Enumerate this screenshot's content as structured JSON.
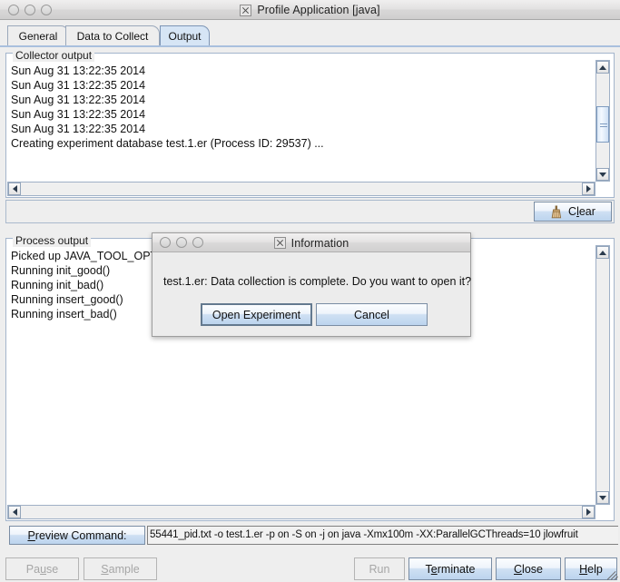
{
  "window": {
    "title": "Profile Application [java]",
    "app_icon": "x-logo-icon",
    "controls": [
      "close-circle",
      "minimize-circle",
      "zoom-circle"
    ]
  },
  "tabs": [
    {
      "label": "General",
      "selected": false
    },
    {
      "label": "Data to Collect",
      "selected": false
    },
    {
      "label": "Output",
      "selected": true
    }
  ],
  "collector_output": {
    "legend": "Collector output",
    "lines": [
      "Sun Aug 31 13:22:35 2014",
      "Sun Aug 31 13:22:35 2014",
      "Sun Aug 31 13:22:35 2014",
      "Sun Aug 31 13:22:35 2014",
      "Sun Aug 31 13:22:35 2014",
      "Creating experiment database test.1.er (Process ID: 29537) ..."
    ]
  },
  "clear_button": {
    "label": "Clear",
    "mnemonic": "l",
    "icon": "broom-icon"
  },
  "process_output": {
    "legend": "Process output",
    "lines": [
      "Picked up JAVA_TOOL_OPT",
      "Running init_good()",
      "Running init_bad()",
      "Running insert_good()",
      "Running insert_bad()"
    ]
  },
  "dialog": {
    "title": "Information",
    "app_icon": "x-logo-icon",
    "message": "test.1.er: Data collection is complete. Do you want to open it?",
    "buttons": [
      {
        "label": "Open Experiment",
        "focused": true
      },
      {
        "label": "Cancel",
        "focused": false
      }
    ]
  },
  "command_row": {
    "button_label": "Preview Command:",
    "button_mnemonic": "P",
    "value": "55441_pid.txt -o test.1.er -p on -S on -j on java -Xmx100m -XX:ParallelGCThreads=10 jlowfruit"
  },
  "footer_buttons": [
    {
      "name": "pause",
      "label": "Pause",
      "pre": "Pa",
      "mn": "u",
      "post": "se",
      "enabled": false
    },
    {
      "name": "sample",
      "label": "Sample",
      "pre": "",
      "mn": "S",
      "post": "ample",
      "enabled": false
    },
    {
      "name": "run",
      "label": "Run",
      "pre": "",
      "mn": "",
      "post": "Run",
      "enabled": false
    },
    {
      "name": "terminate",
      "label": "Terminate",
      "pre": "T",
      "mn": "e",
      "post": "rminate",
      "enabled": true
    },
    {
      "name": "close",
      "label": "Close",
      "pre": "",
      "mn": "C",
      "post": "lose",
      "enabled": true
    },
    {
      "name": "help",
      "label": "Help",
      "pre": "",
      "mn": "H",
      "post": "elp",
      "enabled": true
    }
  ],
  "colors": {
    "tab_selected": "#d6e5f5",
    "panel_border": "#a3b5cc",
    "accent": "#7d95b5",
    "window_bg": "#eeeeee",
    "text": "#111111",
    "disabled_text": "#a6a6a6"
  }
}
